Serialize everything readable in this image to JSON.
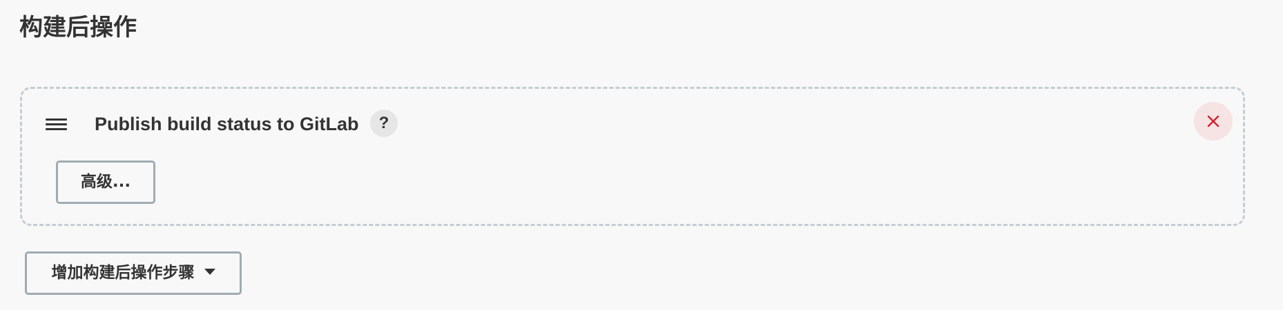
{
  "section": {
    "title": "构建后操作"
  },
  "step": {
    "title": "Publish build status to GitLab",
    "help_label": "?",
    "advanced_label": "高级...",
    "drag_icon": "hamburger-icon",
    "delete_icon": "close-icon"
  },
  "add_step": {
    "label": "增加构建后操作步骤",
    "icon": "caret-down-icon"
  },
  "colors": {
    "background": "#f8f8f8",
    "text": "#333333",
    "dashed_border": "#c3cdd2",
    "button_border": "#9fabb2",
    "delete_bg": "#f6e3e3",
    "delete_icon": "#d2202f",
    "help_bg": "#e6e6e6"
  }
}
